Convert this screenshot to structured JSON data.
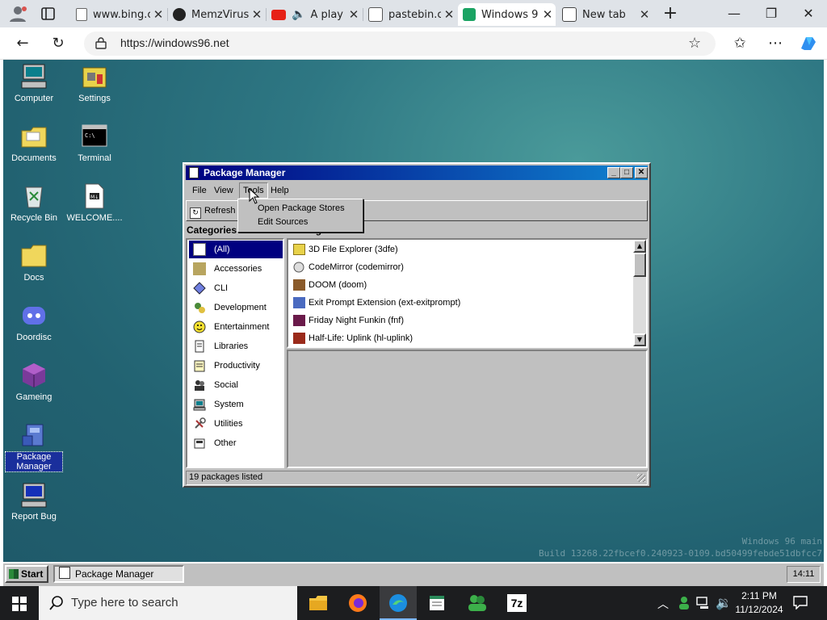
{
  "browser": {
    "tabs": [
      {
        "label": "",
        "type": "profile"
      },
      {
        "label": "",
        "type": "tab-actions"
      },
      {
        "label": "www.bing.c",
        "close": "✕"
      },
      {
        "label": "MemzVirus",
        "close": "✕"
      },
      {
        "label": "A play",
        "close": "✕"
      },
      {
        "label": "pastebin.co",
        "close": "✕"
      },
      {
        "label": "Windows 9",
        "close": "✕"
      },
      {
        "label": "New tab",
        "close": "✕"
      }
    ],
    "new_tab": "+",
    "url": "https://windows96.net"
  },
  "desktop": {
    "icons": [
      {
        "label": "Computer"
      },
      {
        "label": "Settings"
      },
      {
        "label": "Documents"
      },
      {
        "label": "Terminal"
      },
      {
        "label": "Recycle Bin"
      },
      {
        "label": "WELCOME...."
      },
      {
        "label": "Docs"
      },
      {
        "label": "Doordisc"
      },
      {
        "label": "Gameing"
      },
      {
        "label": "Package Manager"
      },
      {
        "label": "Report Bug"
      }
    ],
    "watermark_line1": "Windows 96 main",
    "watermark_line2": "Build 13268.22fbcef0.240923-0109.bd50499febde51dbfcc7"
  },
  "package_manager": {
    "title": "Package Manager",
    "menu": [
      "File",
      "View",
      "Tools",
      "Help"
    ],
    "tools_menu": [
      "Open Package Stores",
      "Edit Sources"
    ],
    "toolbar_refresh": "Refresh",
    "categories_label": "Categories",
    "packages_label": "Packages",
    "categories": [
      "(All)",
      "Accessories",
      "CLI",
      "Development",
      "Entertainment",
      "Libraries",
      "Productivity",
      "Social",
      "System",
      "Utilities",
      "Other"
    ],
    "selected_category": "(All)",
    "packages": [
      "3D File Explorer (3dfe)",
      "CodeMirror (codemirror)",
      "DOOM (doom)",
      "Exit Prompt Extension (ext-exitprompt)",
      "Friday Night Funkin (fnf)",
      "Half-Life: Uplink (hl-uplink)"
    ],
    "status": "19 packages listed"
  },
  "w96_taskbar": {
    "start_label": "Start",
    "task_label": "Package Manager",
    "clock": "14:11"
  },
  "win_taskbar": {
    "search_placeholder": "Type here to search",
    "time": "2:11 PM",
    "date": "11/12/2024"
  }
}
